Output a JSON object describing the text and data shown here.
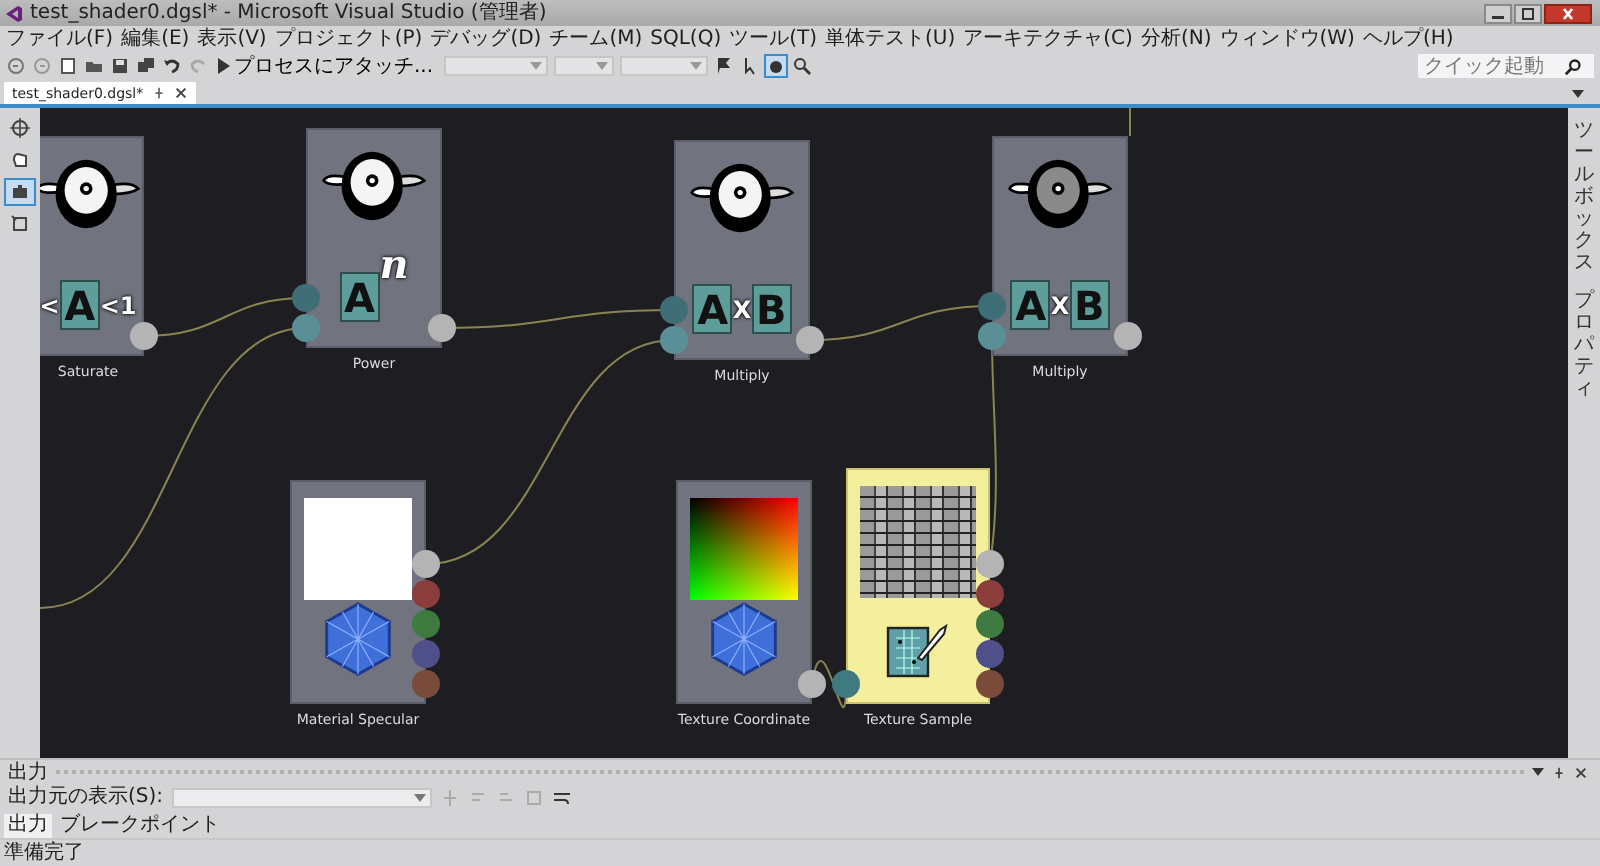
{
  "window": {
    "title": "test_shader0.dgsl* - Microsoft Visual Studio (管理者)"
  },
  "menu": [
    "ファイル(F)",
    "編集(E)",
    "表示(V)",
    "プロジェクト(P)",
    "デバッグ(D)",
    "チーム(M)",
    "SQL(Q)",
    "ツール(T)",
    "単体テスト(U)",
    "アーキテクチャ(C)",
    "分析(N)",
    "ウィンドウ(W)",
    "ヘルプ(H)"
  ],
  "toolbar": {
    "attach_label": "プロセスにアタッチ...",
    "quick_launch": {
      "placeholder": "クイック起動"
    }
  },
  "document_tabs": [
    {
      "label": "test_shader0.dgsl*",
      "selected": true
    }
  ],
  "toolbox_tools": [
    {
      "kind": "pointer",
      "selected": false
    },
    {
      "kind": "pan",
      "selected": false
    },
    {
      "kind": "select",
      "selected": true
    },
    {
      "kind": "frame",
      "selected": false
    }
  ],
  "side_tabs": [
    "ツールボックス",
    "プロパティ"
  ],
  "nodes": [
    {
      "label": "Saturate",
      "preview": {
        "kind": "teapot-light"
      },
      "symbol": [
        {
          "text": "<",
          "kind": "mark"
        },
        {
          "text": "A",
          "kind": "tile"
        },
        {
          "text": "<1",
          "kind": "mark"
        }
      ],
      "outputs": [
        {
          "color": "#b4b4b4"
        }
      ],
      "selected": false
    },
    {
      "label": "Power",
      "preview": {
        "kind": "teapot-light"
      },
      "symbol": [
        {
          "text": "A",
          "kind": "tile"
        },
        {
          "text": "n",
          "kind": "sup"
        }
      ],
      "inputs": [
        {
          "color": "#3f6e76"
        },
        {
          "color": "#5b8f98"
        }
      ],
      "outputs": [
        {
          "color": "#b4b4b4"
        }
      ],
      "selected": false
    },
    {
      "label": "Multiply",
      "preview": {
        "kind": "teapot-light"
      },
      "symbol": [
        {
          "text": "A",
          "kind": "tile"
        },
        {
          "text": "X",
          "kind": "mark"
        },
        {
          "text": "B",
          "kind": "tile"
        }
      ],
      "inputs": [
        {
          "color": "#3f6e76"
        },
        {
          "color": "#5b8f98"
        }
      ],
      "outputs": [
        {
          "color": "#b4b4b4"
        }
      ],
      "selected": false
    },
    {
      "label": "Multiply",
      "preview": {
        "kind": "teapot-dark"
      },
      "symbol": [
        {
          "text": "A",
          "kind": "tile"
        },
        {
          "text": "X",
          "kind": "mark"
        },
        {
          "text": "B",
          "kind": "tile"
        }
      ],
      "inputs": [
        {
          "color": "#3f6e76"
        },
        {
          "color": "#5b8f98"
        }
      ],
      "outputs": [
        {
          "color": "#b4b4b4"
        }
      ],
      "selected": false
    },
    {
      "label": "Material Specular",
      "preview": {
        "kind": "swatch"
      },
      "badge": {
        "kind": "gem"
      },
      "outputs": [
        {
          "color": "#b4b4b4"
        },
        {
          "color": "#8a3d3a"
        },
        {
          "color": "#3f7a40"
        },
        {
          "color": "#4f4f8a"
        },
        {
          "color": "#7a4a3a"
        }
      ],
      "selected": false
    },
    {
      "label": "Texture Coordinate",
      "preview": {
        "kind": "gradient"
      },
      "badge": {
        "kind": "gem"
      },
      "outputs": [
        {
          "color": "#b4b4b4"
        }
      ],
      "selected": false
    },
    {
      "label": "Texture Sample",
      "preview": {
        "kind": "brick"
      },
      "badge": {
        "kind": "texture"
      },
      "inputs": [
        {
          "color": "#3f7a80"
        }
      ],
      "outputs": [
        {
          "color": "#b4b4b4"
        },
        {
          "color": "#8a3d3a"
        },
        {
          "color": "#3f7a40"
        },
        {
          "color": "#4f4f8a"
        },
        {
          "color": "#7a4a3a"
        }
      ],
      "selected": true
    }
  ],
  "output": {
    "title": "出力",
    "source_label": "出力元の表示(S):",
    "tabs": [
      {
        "label": "出力",
        "selected": true
      },
      {
        "label": "ブレークポイント",
        "selected": false
      }
    ]
  },
  "status_bar": {
    "text": "準備完了"
  }
}
